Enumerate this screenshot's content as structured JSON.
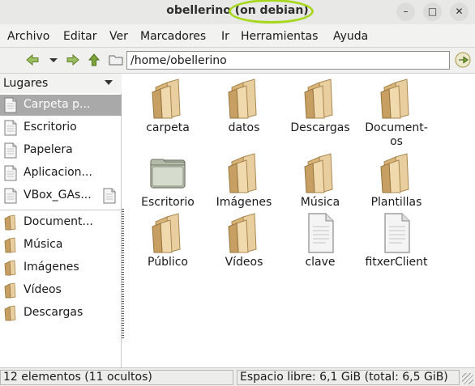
{
  "window": {
    "title_user": "obellerino",
    "title_host": "(on debian)",
    "buttons": {
      "minimize": "–",
      "maximize": "□",
      "close": "✕"
    }
  },
  "menubar": {
    "items": [
      "Archivo",
      "Editar",
      "Ver",
      "Marcadores",
      "Ir",
      "Herramientas",
      "Ayuda"
    ]
  },
  "toolbar": {
    "path": "/home/obellerino",
    "icons": [
      "back-arrow-icon",
      "history-dropdown-icon",
      "forward-arrow-icon",
      "up-arrow-icon",
      "folder-icon",
      "go-arrow-icon"
    ]
  },
  "sidebar": {
    "header": "Lugares",
    "places": [
      {
        "label": "Carpeta p...",
        "icon": "document-icon",
        "selected": true
      },
      {
        "label": "Escritorio",
        "icon": "document-icon"
      },
      {
        "label": "Papelera",
        "icon": "document-icon"
      },
      {
        "label": "Aplicacion...",
        "icon": "document-icon"
      },
      {
        "label": "VBox_GAs...",
        "icon": "document-icon"
      }
    ],
    "bookmarks": [
      {
        "label": "Document...",
        "icon": "folder-icon"
      },
      {
        "label": "Música",
        "icon": "folder-icon"
      },
      {
        "label": "Imágenes",
        "icon": "folder-icon"
      },
      {
        "label": "Vídeos",
        "icon": "folder-icon"
      },
      {
        "label": "Descargas",
        "icon": "folder-icon"
      }
    ]
  },
  "files": [
    {
      "name": "carpeta",
      "type": "folder"
    },
    {
      "name": "datos",
      "type": "folder"
    },
    {
      "name": "Descargas",
      "type": "folder"
    },
    {
      "name": "Document-\nos",
      "type": "folder"
    },
    {
      "name": "Escritorio",
      "type": "desktop-folder"
    },
    {
      "name": "Imágenes",
      "type": "folder"
    },
    {
      "name": "Música",
      "type": "folder"
    },
    {
      "name": "Plantillas",
      "type": "folder"
    },
    {
      "name": "Público",
      "type": "folder"
    },
    {
      "name": "Vídeos",
      "type": "folder"
    },
    {
      "name": "clave",
      "type": "file"
    },
    {
      "name": "fitxerClient",
      "type": "file"
    }
  ],
  "status": {
    "left": "12 elementos (11 ocultos)",
    "right": "Espacio libre: 6,1 GiB (total: 6,5 GiB)"
  },
  "colors": {
    "folder_body": "#e6c996",
    "folder_shade": "#b8955c",
    "desktop_folder": "#c9cfc0",
    "selection": "#a9a9a9",
    "arrow_green": "#7ea53a",
    "highlight_ring": "#a8d81e"
  }
}
